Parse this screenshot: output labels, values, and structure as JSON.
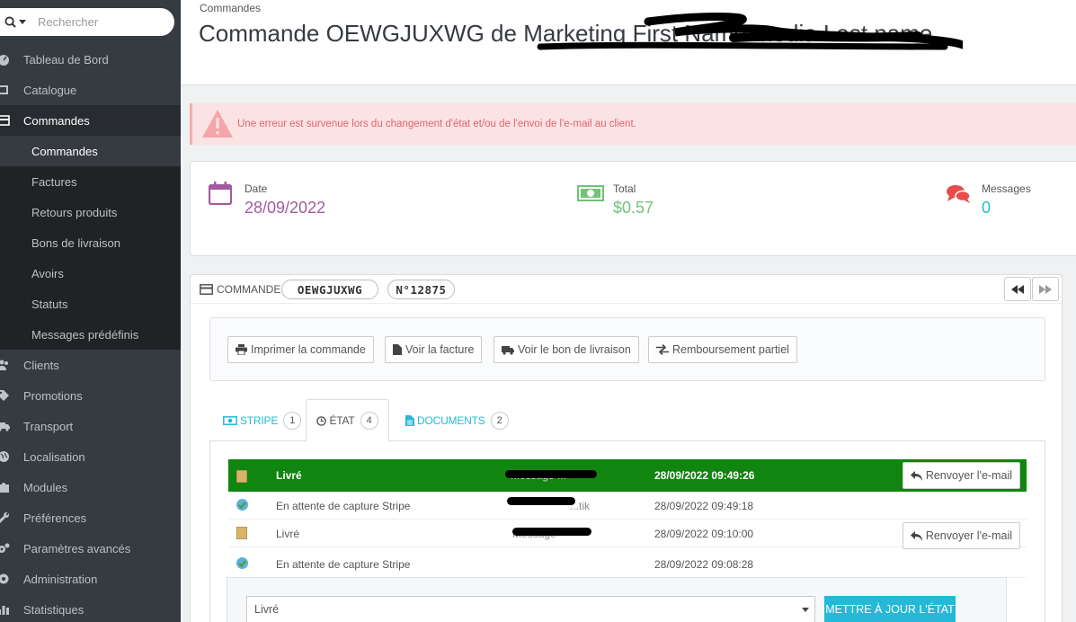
{
  "search": {
    "placeholder": "Rechercher"
  },
  "sidebar": {
    "items": [
      {
        "label": "Tableau de Bord",
        "icon": "dashboard-icon"
      },
      {
        "label": "Catalogue",
        "icon": "catalog-icon"
      },
      {
        "label": "Commandes",
        "icon": "orders-icon"
      },
      {
        "label": "Clients",
        "icon": "customers-icon"
      },
      {
        "label": "Promotions",
        "icon": "tag-icon"
      },
      {
        "label": "Transport",
        "icon": "truck-icon"
      },
      {
        "label": "Localisation",
        "icon": "globe-icon"
      },
      {
        "label": "Modules",
        "icon": "puzzle-icon"
      },
      {
        "label": "Préférences",
        "icon": "wrench-icon"
      },
      {
        "label": "Paramètres avancés",
        "icon": "cogs-icon"
      },
      {
        "label": "Administration",
        "icon": "gear-icon"
      },
      {
        "label": "Statistiques",
        "icon": "bar-chart-icon"
      }
    ],
    "submenu": [
      {
        "label": "Commandes"
      },
      {
        "label": "Factures"
      },
      {
        "label": "Retours produits"
      },
      {
        "label": "Bons de livraison"
      },
      {
        "label": "Avoirs"
      },
      {
        "label": "Statuts"
      },
      {
        "label": "Messages prédéfinis"
      }
    ]
  },
  "header": {
    "breadcrumb": "Commandes",
    "title": "Commande OEWGJUXWG de Marketing First Name media Last name"
  },
  "alert": {
    "text": "Une erreur est survenue lors du changement d'état et/ou de l'envoi de l'e-mail au client."
  },
  "kpi": {
    "date": {
      "label": "Date",
      "value": "28/09/2022"
    },
    "total": {
      "label": "Total",
      "value": "$0.57"
    },
    "messages": {
      "label": "Messages",
      "value": "0"
    }
  },
  "order": {
    "title": "COMMANDE",
    "reference": "OEWGJUXWG",
    "number": "N°12875",
    "actions": {
      "print": "Imprimer la commande",
      "invoice": "Voir la facture",
      "delivery": "Voir le bon de livraison",
      "refund": "Remboursement partiel"
    },
    "tabs": [
      {
        "label": "STRIPE",
        "count": "1"
      },
      {
        "label": "ÉTAT",
        "count": "4"
      },
      {
        "label": "DOCUMENTS",
        "count": "2"
      }
    ],
    "history": [
      {
        "status": "Livré",
        "employee": "Message ...",
        "date": "28/09/2022 09:49:26",
        "action": "Renvoyer l'e-mail"
      },
      {
        "status": "En attente de capture Stripe",
        "employee": "...tik",
        "date": "28/09/2022 09:49:18",
        "action": ""
      },
      {
        "status": "Livré",
        "employee": "Message",
        "date": "28/09/2022 09:10:00",
        "action": "Renvoyer l'e-mail"
      },
      {
        "status": "En attente de capture Stripe",
        "employee": "",
        "date": "28/09/2022 09:08:28",
        "action": ""
      }
    ],
    "status_select": {
      "value": "Livré"
    },
    "update_button": "METTRE À JOUR L'ÉTAT"
  },
  "colors": {
    "accent": "#25b9d7",
    "delivered": "#108510",
    "error_bg": "#fbe2e3",
    "date": "#a15b9e",
    "total": "#72c279",
    "messages": "#e94b4b"
  }
}
